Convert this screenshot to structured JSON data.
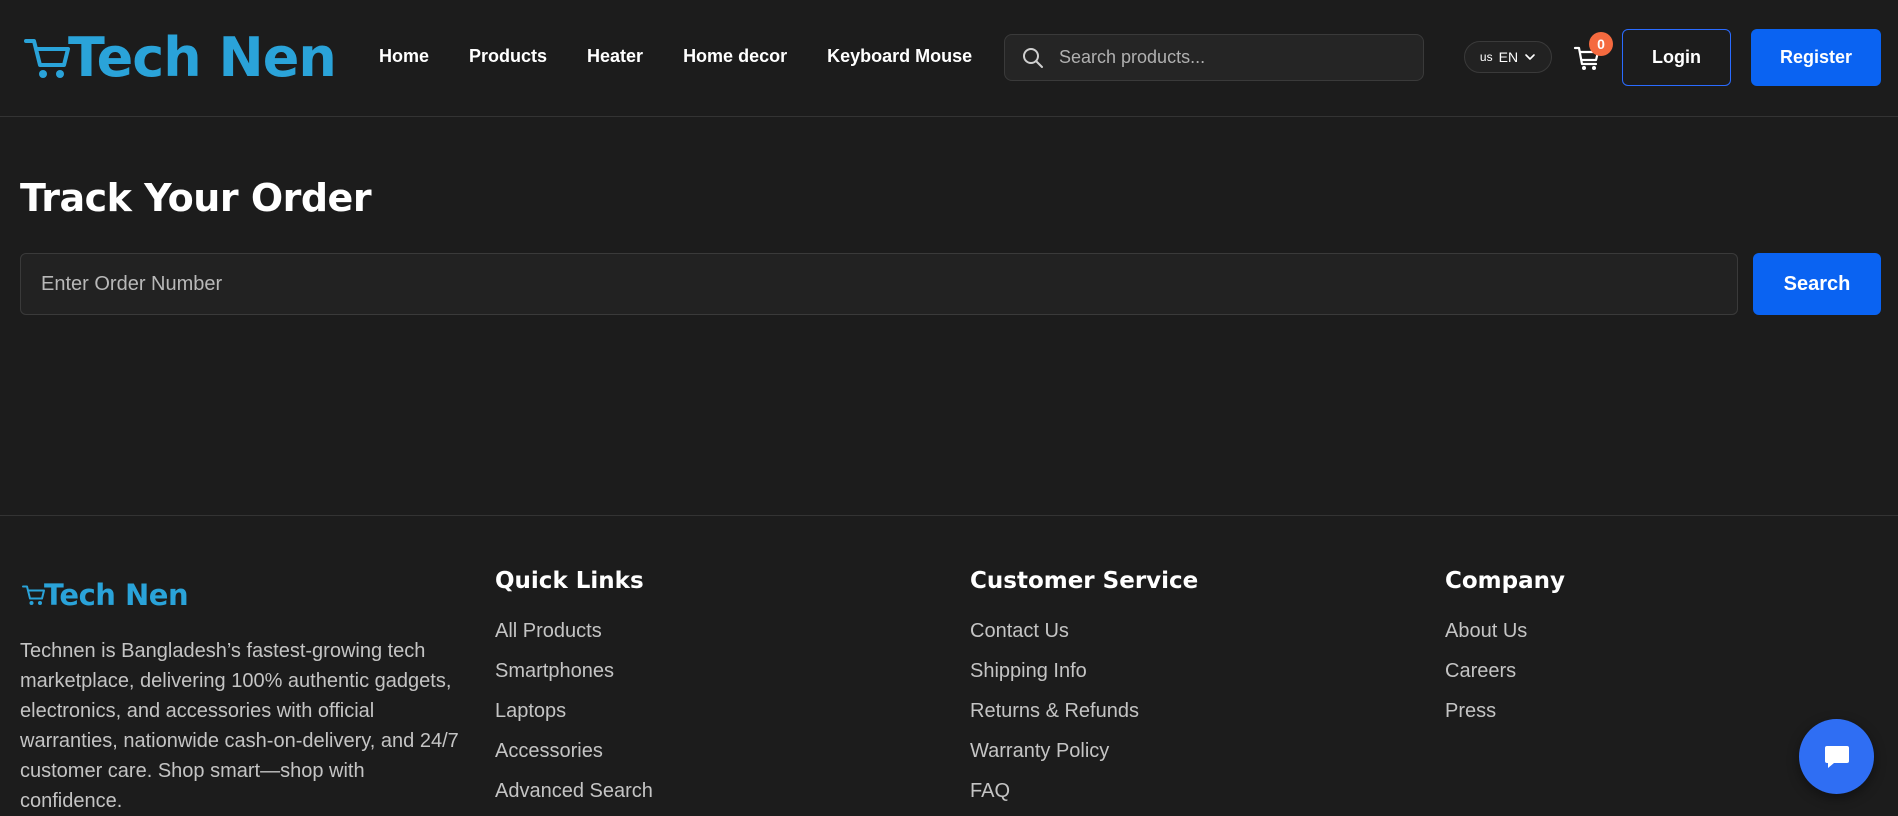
{
  "header": {
    "logo_text": "Tech Nen",
    "nav": [
      {
        "label": "Home"
      },
      {
        "label": "Products"
      },
      {
        "label": "Heater"
      },
      {
        "label": "Home decor"
      },
      {
        "label": "Keyboard Mouse"
      }
    ],
    "search_placeholder": "Search products...",
    "language": {
      "flag": "us",
      "code": "EN"
    },
    "cart_count": "0",
    "login_label": "Login",
    "register_label": "Register"
  },
  "main": {
    "title": "Track Your Order",
    "order_placeholder": "Enter Order Number",
    "search_label": "Search"
  },
  "footer": {
    "logo_text": "Tech Nen",
    "description": "Technen is Bangladesh’s fastest-growing tech marketplace, delivering 100% authentic gadgets, electronics, and accessories with official warranties, nationwide cash-on-delivery, and 24/7 customer care. Shop smart—shop with confidence.",
    "columns": [
      {
        "title": "Quick Links",
        "links": [
          "All Products",
          "Smartphones",
          "Laptops",
          "Accessories",
          "Advanced Search"
        ]
      },
      {
        "title": "Customer Service",
        "links": [
          "Contact Us",
          "Shipping Info",
          "Returns & Refunds",
          "Warranty Policy",
          "FAQ"
        ]
      },
      {
        "title": "Company",
        "links": [
          "About Us",
          "Careers",
          "Press"
        ]
      }
    ]
  },
  "colors": {
    "background": "#1c1c1c",
    "brand": "#2aa3d9",
    "primary_button": "#0a63f2",
    "badge": "#f56a3f",
    "chat_button": "#2f6ef3"
  },
  "icons": [
    "cart-logo-icon",
    "search-icon",
    "chevron-down-icon",
    "cart-icon",
    "chat-icon"
  ]
}
